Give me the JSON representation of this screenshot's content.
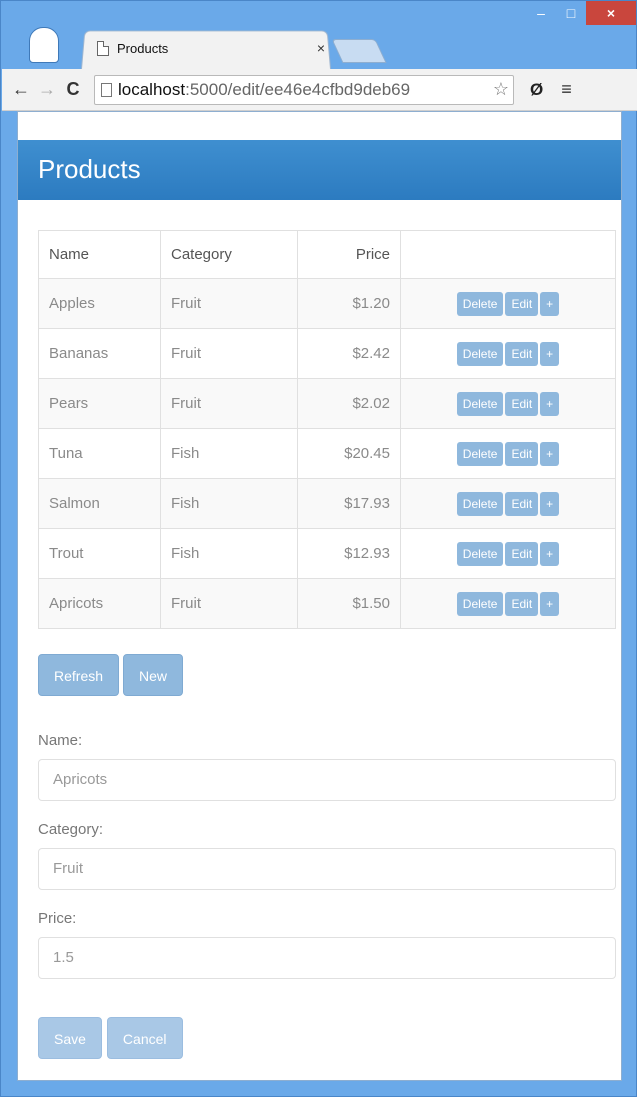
{
  "browser": {
    "tab_title": "Products",
    "tab_close": "×",
    "url_host": "localhost",
    "url_path": ":5000/edit/ee46e4cfbd9deb69",
    "back": "←",
    "forward": "→",
    "reload": "C",
    "star": "☆",
    "ext": "Ø",
    "menu": "≡",
    "min": "–",
    "max": "□",
    "close": "×"
  },
  "page": {
    "header": "Products",
    "table": {
      "headers": [
        "Name",
        "Category",
        "Price",
        ""
      ],
      "rows": [
        {
          "name": "Apples",
          "category": "Fruit",
          "price": "$1.20"
        },
        {
          "name": "Bananas",
          "category": "Fruit",
          "price": "$2.42"
        },
        {
          "name": "Pears",
          "category": "Fruit",
          "price": "$2.02"
        },
        {
          "name": "Tuna",
          "category": "Fish",
          "price": "$20.45"
        },
        {
          "name": "Salmon",
          "category": "Fish",
          "price": "$17.93"
        },
        {
          "name": "Trout",
          "category": "Fish",
          "price": "$12.93"
        },
        {
          "name": "Apricots",
          "category": "Fruit",
          "price": "$1.50"
        }
      ],
      "row_actions": {
        "delete": "Delete",
        "edit": "Edit",
        "plus": "+"
      }
    },
    "buttons": {
      "refresh": "Refresh",
      "new": "New",
      "save": "Save",
      "cancel": "Cancel"
    },
    "form": {
      "name_label": "Name:",
      "name_value": "Apricots",
      "category_label": "Category:",
      "category_value": "Fruit",
      "price_label": "Price:",
      "price_value": "1.5"
    }
  }
}
